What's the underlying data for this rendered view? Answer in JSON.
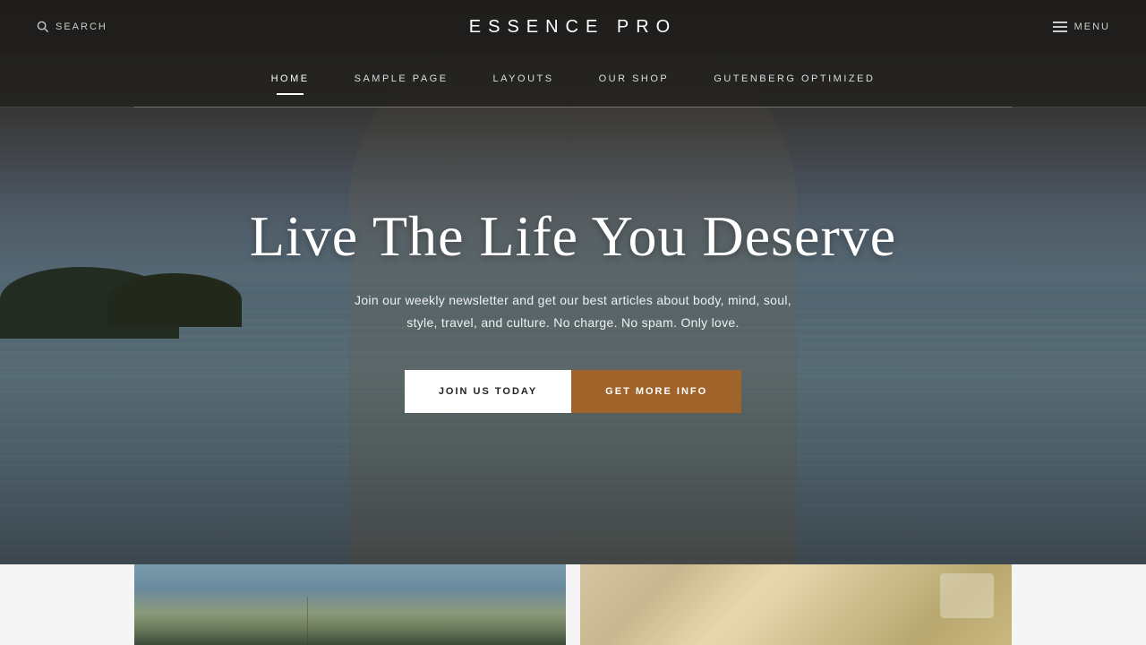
{
  "site": {
    "title": "ESSENCE  PRO"
  },
  "topbar": {
    "search_label": "SEARCH",
    "menu_label": "MENU"
  },
  "nav": {
    "items": [
      {
        "label": "HOME",
        "active": true
      },
      {
        "label": "SAMPLE PAGE",
        "active": false
      },
      {
        "label": "LAYOUTS",
        "active": false
      },
      {
        "label": "OUR SHOP",
        "active": false
      },
      {
        "label": "GUTENBERG OPTIMIZED",
        "active": false
      }
    ]
  },
  "hero": {
    "title": "Live The Life You Deserve",
    "subtitle_line1": "Join our weekly newsletter and get our best articles about body, mind, soul,",
    "subtitle_line2": "style, travel, and culture. No charge. No spam. Only love.",
    "btn_join": "JOIN US TODAY",
    "btn_info": "GET MORE INFO"
  },
  "colors": {
    "btn_join_bg": "#ffffff",
    "btn_info_bg": "#a0632a",
    "accent": "#a0632a"
  }
}
